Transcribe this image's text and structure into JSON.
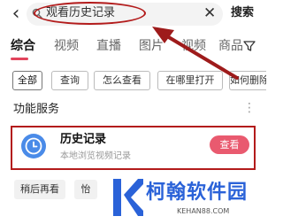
{
  "header": {
    "back_icon": "back-arrow-icon",
    "search_query": "观看历史记录",
    "search_button": "搜索"
  },
  "tabs": [
    {
      "label": "综合",
      "active": true
    },
    {
      "label": "视频",
      "active": false
    },
    {
      "label": "直播",
      "active": false
    },
    {
      "label": "图片",
      "active": false
    },
    {
      "label": "视频",
      "active": false
    },
    {
      "label": "商品",
      "active": false
    }
  ],
  "chips": [
    "全部",
    "查询",
    "怎么查看",
    "在哪里打开",
    "如何删除"
  ],
  "section": {
    "title": "功能服务",
    "more": "⋮"
  },
  "card": {
    "title": "历史记录",
    "subtitle": "本地浏览视频记录",
    "button": "查看"
  },
  "bottom_chips": [
    "稍后再看",
    "怡"
  ],
  "watermark": {
    "name": "柯翰软件园",
    "domain": "KEHAN88.COM"
  },
  "colors": {
    "accent": "#e95a6f",
    "annotation": "#b31b1b",
    "brand": "#2a62d8",
    "clock": "#4a8be8"
  }
}
